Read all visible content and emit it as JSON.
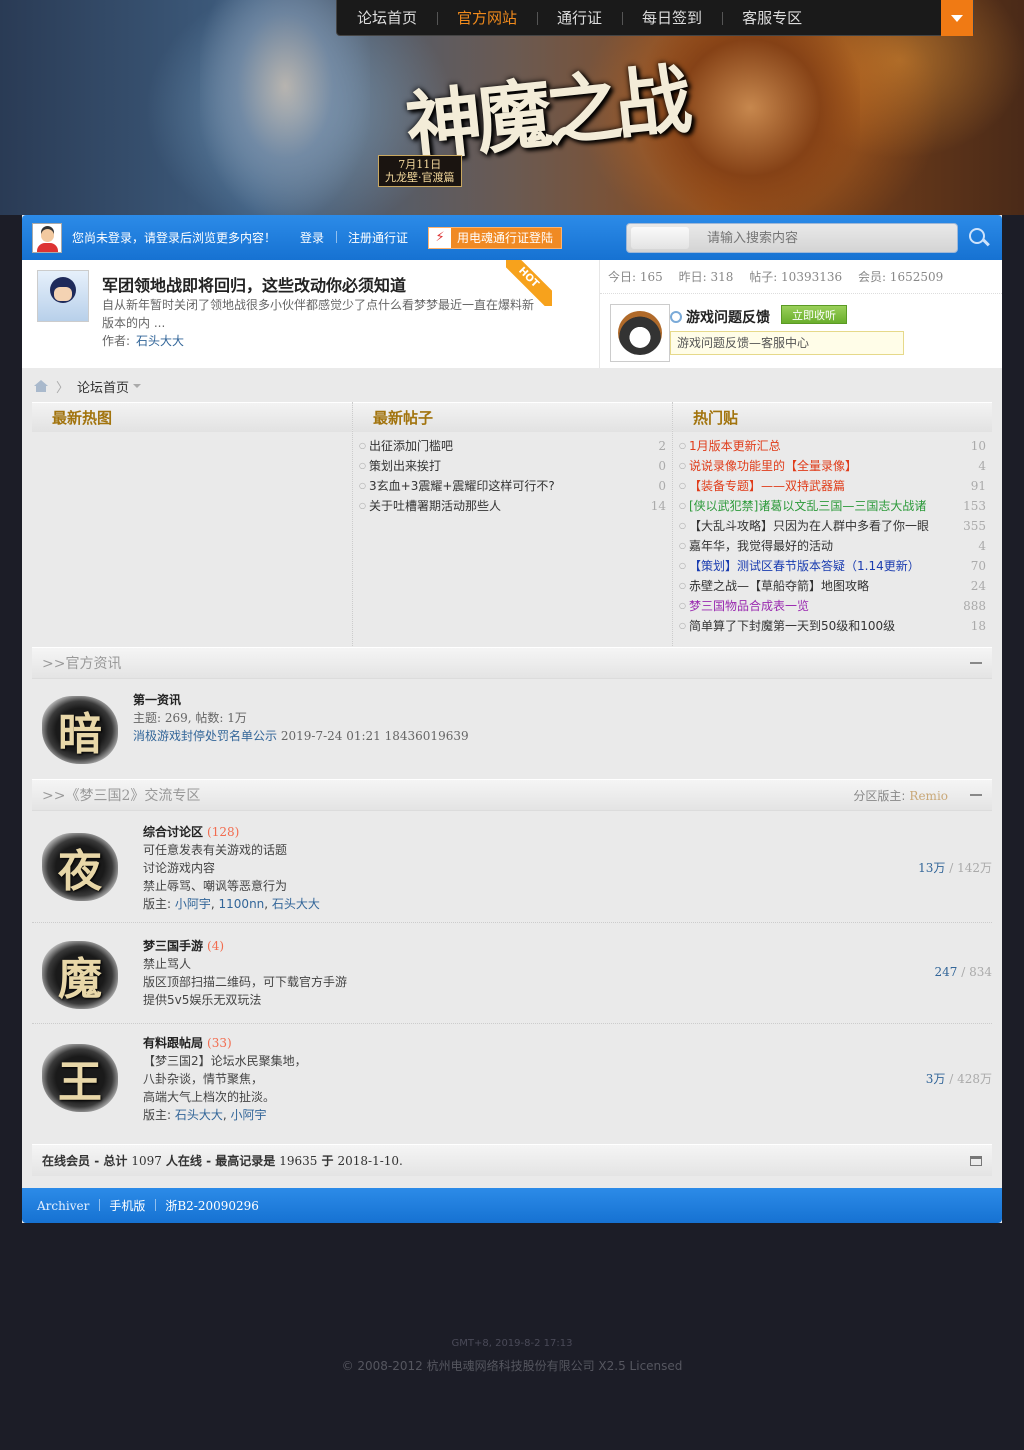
{
  "topnav": {
    "items": [
      "论坛首页",
      "官方网站",
      "通行证",
      "每日签到",
      "客服专区"
    ],
    "active_index": 1,
    "accent": "#f08a1c"
  },
  "banner": {
    "logo_text": "神魔之战",
    "date_line1": "7月11日",
    "date_line2": "九龙壁·官渡篇"
  },
  "userbar": {
    "notice": "您尚未登录，请登录后浏览更多内容！",
    "login": "登录",
    "register": "注册通行证",
    "dz_login": "用电魂通行证登陆",
    "search_placeholder": "请输入搜索内容"
  },
  "hotpost": {
    "badge": "HOT",
    "title": "军团领地战即将回归，这些改动你必须知道",
    "excerpt": "自从新年暂时关闭了领地战很多小伙伴都感觉少了点什么看梦梦最近一直在爆料新版本的内 ...",
    "author_label": "作者:",
    "author": "石头大大"
  },
  "stats": {
    "today": "今日: 165",
    "yesterday": "昨日: 318",
    "posts": "帖子: 10393136",
    "members": "会员: 1652509"
  },
  "feedback": {
    "name": "游戏问题反馈",
    "follow": "立即收听",
    "desc": "游戏问题反馈—客服中心"
  },
  "breadcrumb": {
    "home": "论坛首页"
  },
  "columns": {
    "latest_pics": {
      "title": "最新热图"
    },
    "latest_posts": {
      "title": "最新帖子",
      "items": [
        {
          "title": "出征添加门槛吧",
          "count": "2"
        },
        {
          "title": "策划出来挨打",
          "count": "0"
        },
        {
          "title": "3玄血+3震耀+震耀印这样可行不?",
          "count": "0"
        },
        {
          "title": "关于吐槽署期活动那些人",
          "count": "14"
        }
      ]
    },
    "hot_posts": {
      "title": "热门贴",
      "items": [
        {
          "title": "1月版本更新汇总",
          "count": "10",
          "color": "#e03c1a"
        },
        {
          "title": "说说录像功能里的【全量录像】",
          "count": "4",
          "color": "#e03c1a"
        },
        {
          "title": "【装备专题】——双持武器篇",
          "count": "91",
          "color": "#e03c1a"
        },
        {
          "title": "[侠以武犯禁]诸葛以文乱三国—三国志大战诸",
          "count": "153",
          "color": "#2c9a3a"
        },
        {
          "title": "【大乱斗攻略】只因为在人群中多看了你一眼",
          "count": "355",
          "color": "#333333"
        },
        {
          "title": "嘉年华，我觉得最好的活动",
          "count": "4",
          "color": "#333333"
        },
        {
          "title": "【策划】测试区春节版本答疑（1.14更新）",
          "count": "70",
          "color": "#1a3cb0"
        },
        {
          "title": "赤壁之战—【草船夺箭】地图攻略",
          "count": "24",
          "color": "#333333"
        },
        {
          "title": "梦三国物品合成表一览",
          "count": "888",
          "color": "#9a2ab0"
        },
        {
          "title": "简单算了下封魔第一天到50级和100级",
          "count": "18",
          "color": "#333333"
        }
      ]
    }
  },
  "cat_official": {
    "title": ">>官方资讯",
    "forum": {
      "icon": "暗",
      "name": "第一资讯",
      "stats": "主题: 269, 帖数: 1万",
      "last_post": "消极游戏封停处罚名单公示",
      "last_time": "2019-7-24 01:21",
      "last_user": "18436019639"
    }
  },
  "cat_m3": {
    "title": ">>《梦三国2》交流专区",
    "mods_label": "分区版主:",
    "mods": "Remio",
    "forums": [
      {
        "icon": "夜",
        "name": "综合讨论区",
        "count": "(128)",
        "lines": [
          "可任意发表有关游戏的话题",
          "讨论游戏内容",
          "禁止辱骂、嘲讽等恶意行为"
        ],
        "mods_label": "版主:",
        "mods": [
          "小阿宇",
          "1100nn",
          "石头大大"
        ],
        "topics": "13万",
        "posts": "142万"
      },
      {
        "icon": "魔",
        "name": "梦三国手游",
        "count": "(4)",
        "lines": [
          "禁止骂人",
          "版区顶部扫描二维码，可下载官方手游",
          "提供5v5娱乐无双玩法"
        ],
        "topics": "247",
        "posts": "834"
      },
      {
        "icon": "王",
        "name": "有料跟帖局",
        "count": "(33)",
        "lines": [
          "【梦三国2】论坛水民聚集地，",
          "八卦杂谈，情节聚焦，",
          "高端大气上档次的扯淡。"
        ],
        "mods_label": "版主:",
        "mods": [
          "石头大大",
          "小阿宇"
        ],
        "topics": "3万",
        "posts": "428万"
      }
    ]
  },
  "online": {
    "label": "在线会员",
    "total_label": "- 总计",
    "total": "1097",
    "mid": "人在线 - 最高记录是",
    "record": "19635",
    "on": "于",
    "date": "2018-1-10."
  },
  "footer": {
    "links": [
      "Archiver",
      "手机版",
      "浙B2-20090296"
    ],
    "time": "GMT+8, 2019-8-2 17:13",
    "copyright": "© 2008-2012 杭州电魂网络科技股份有限公司 X2.5 Licensed"
  }
}
